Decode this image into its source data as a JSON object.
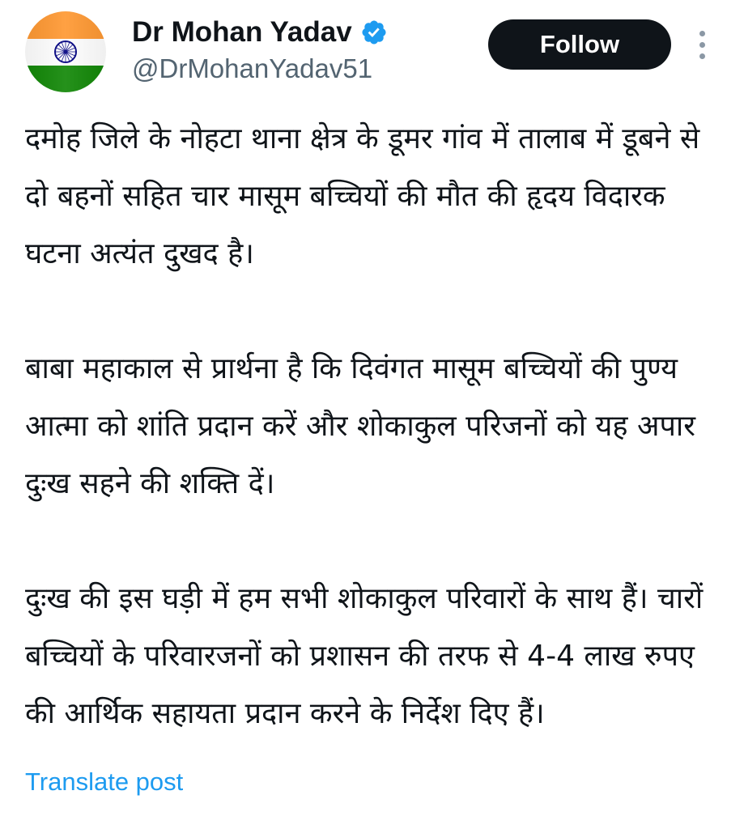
{
  "author": {
    "display_name": "Dr Mohan Yadav",
    "handle": "@DrMohanYadav51",
    "verified": true,
    "avatar_icon": "indian-flag-avatar",
    "verified_icon": "verified-badge-icon"
  },
  "actions": {
    "follow_label": "Follow",
    "more_icon": "more-options-icon"
  },
  "post": {
    "paragraphs": [
      "दमोह जिले के नोहटा थाना क्षेत्र के डूमर गांव में तालाब में डूबने से दो बहनों सहित चार मासूम बच्चियों की मौत की हृदय विदारक घटना अत्यंत दुखद है।",
      "बाबा महाकाल से प्रार्थना है कि दिवंगत मासूम बच्चियों की पुण्य आत्मा को शांति प्रदान करें और शोकाकुल परिजनों को यह अपार दुःख सहने की शक्ति दें।",
      "दुःख की इस घड़ी में हम सभी शोकाकुल परिवारों के साथ हैं। चारों बच्चियों के परिवारजनों को प्रशासन की तरफ से 4-4 लाख रुपए की आर्थिक सहायता प्रदान करने के निर्देश दिए हैं।"
    ],
    "translate_label": "Translate post"
  },
  "colors": {
    "text_primary": "#0f1419",
    "text_secondary": "#536471",
    "link": "#1d9bf0",
    "verified": "#1d9bf0",
    "follow_bg": "#0f1419",
    "follow_text": "#ffffff",
    "flag_saffron": "#ff9933",
    "flag_white": "#ffffff",
    "flag_green": "#138808",
    "flag_chakra": "#000080"
  }
}
